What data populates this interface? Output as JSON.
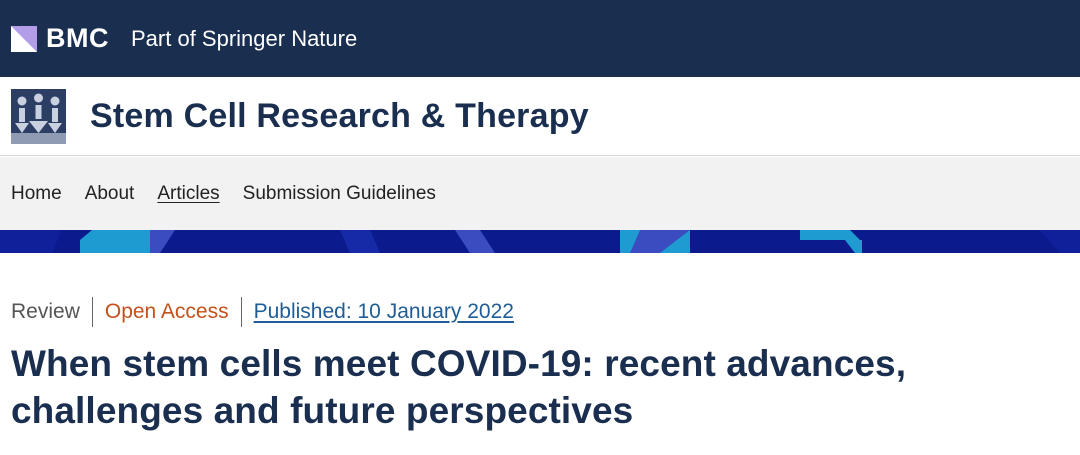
{
  "header": {
    "brand": "BMC",
    "tagline": "Part of Springer Nature"
  },
  "journal": {
    "title": "Stem Cell Research & Therapy"
  },
  "nav": {
    "items": [
      {
        "label": "Home"
      },
      {
        "label": "About"
      },
      {
        "label": "Articles"
      },
      {
        "label": "Submission Guidelines"
      }
    ],
    "active": "Articles"
  },
  "article": {
    "type": "Review",
    "access": "Open Access",
    "published": "Published: 10 January 2022",
    "title": "When stem cells meet COVID-19: recent advances, challenges and future perspectives"
  },
  "colors": {
    "header_bg": "#1a2e4f",
    "brand_accent": "#b29ee8",
    "open_access": "#c4501a",
    "link": "#1f5d97",
    "banner_dark": "#0b1a8c",
    "banner_cyan": "#1e9cd1"
  },
  "icons": {
    "bmc": "bmc-square-logo-icon",
    "journal": "stem-cell-journal-logo-icon"
  }
}
